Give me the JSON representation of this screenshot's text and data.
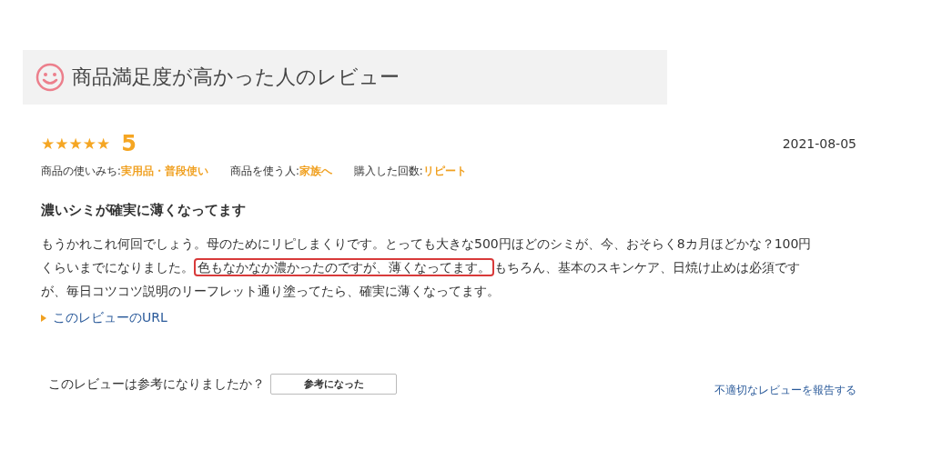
{
  "section_header": {
    "title": "商品満足度が高かった人のレビュー"
  },
  "review": {
    "stars": 5,
    "rating": "5",
    "date": "2021-08-05",
    "attributes": [
      {
        "label": "商品の使いみち:",
        "value": "実用品・普段使い"
      },
      {
        "label": "商品を使う人:",
        "value": "家族へ"
      },
      {
        "label": "購入した回数:",
        "value": "リピート"
      }
    ],
    "title": "濃いシミが確実に薄くなってます",
    "body": {
      "before": "もうかれこれ何回でしょう。母のためにリピしまくりです。とっても大きな500円ほどのシミが、今、おそらく8カ月ほどかな？100円くらいまでになりました。",
      "highlighted": "色もなかなか濃かったのですが、薄くなってます。",
      "after": "もちろん、基本のスキンケア、日焼け止めは必須ですが、毎日コツコツ説明のリーフレット通り塗ってたら、確実に薄くなってます。"
    },
    "url_link": "このレビューのURL",
    "helpful_question": "このレビューは参考になりましたか？",
    "helpful_button": "参考になった",
    "report_link": "不適切なレビューを報告する"
  }
}
